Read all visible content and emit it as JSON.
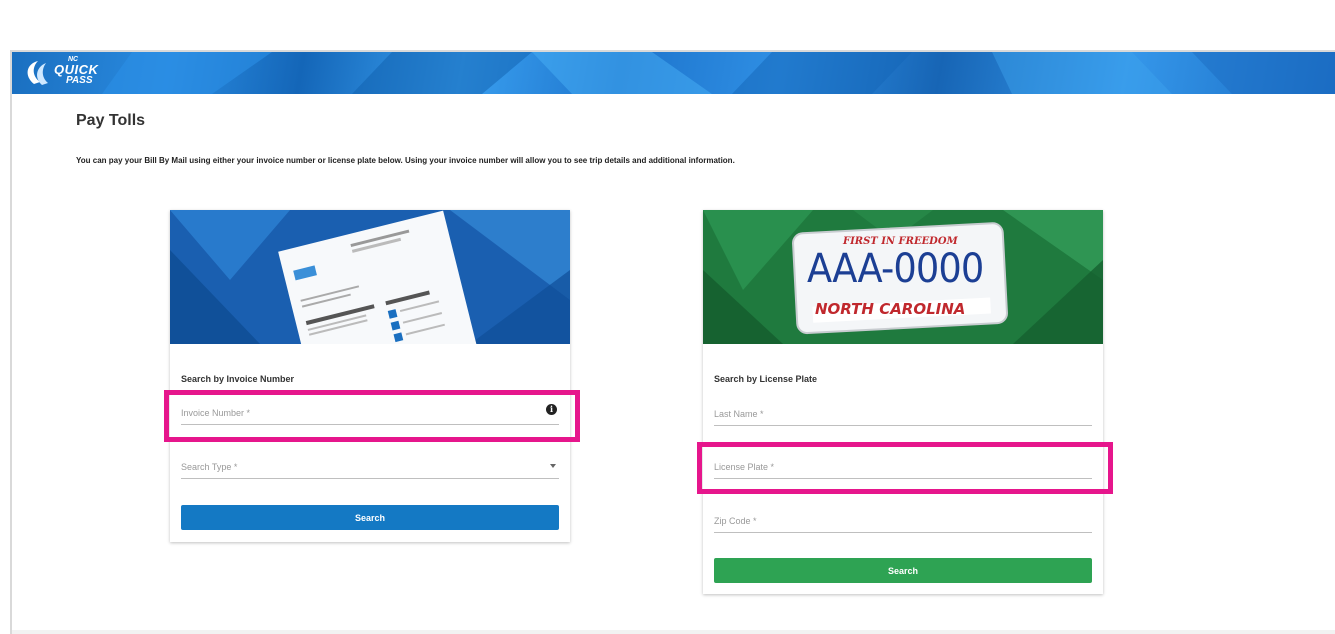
{
  "app": {
    "logo_text_top": "NC",
    "logo_text_main": "QUICK",
    "logo_text_sub": "PASS"
  },
  "page": {
    "title": "Pay Tolls",
    "intro": "You can pay your Bill By Mail using either your invoice number or license plate below. Using your invoice number will allow you to see trip details and additional information."
  },
  "invoice_card": {
    "title": "Search by Invoice Number",
    "invoice_placeholder": "Invoice Number *",
    "search_type_placeholder": "Search Type *",
    "button_label": "Search"
  },
  "plate_card": {
    "title": "Search by License Plate",
    "plate_image": {
      "top_text": "FIRST IN FREEDOM",
      "number": "AAA-0000",
      "state": "NORTH CAROLINA"
    },
    "last_name_placeholder": "Last Name *",
    "license_plate_placeholder": "License Plate *",
    "zip_placeholder": "Zip Code *",
    "button_label": "Search"
  },
  "colors": {
    "header_blue": "#1a6fc0",
    "search_blue": "#1479c4",
    "search_green": "#2ea353",
    "highlight_pink": "#e6168c"
  }
}
